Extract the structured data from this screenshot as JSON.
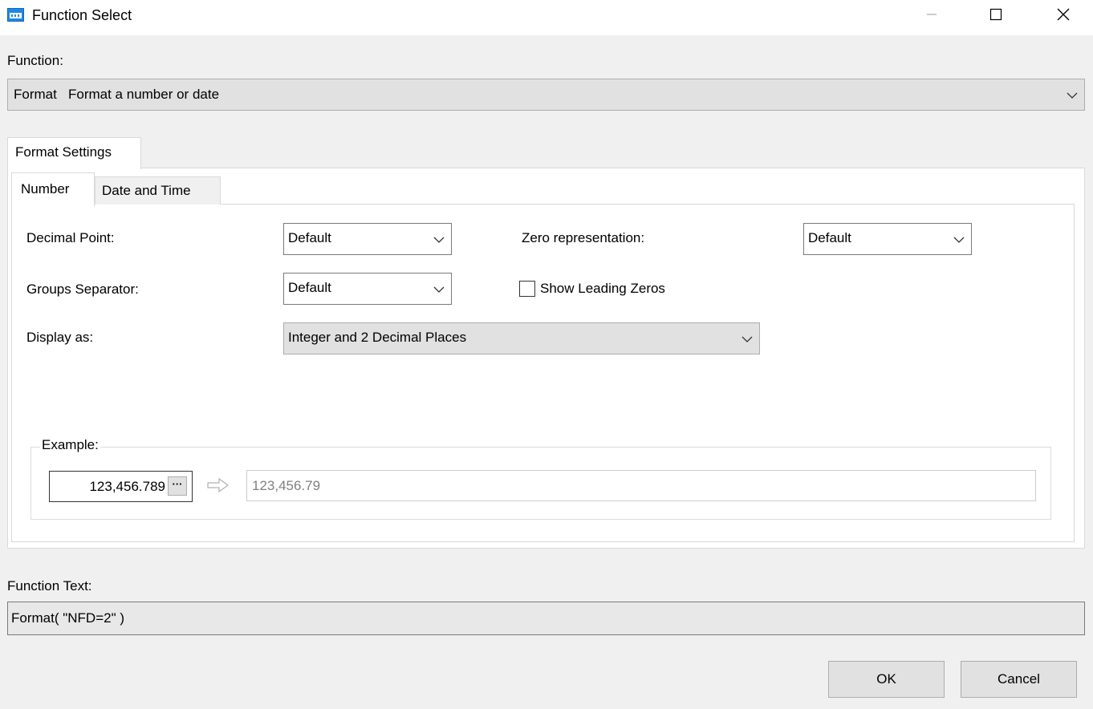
{
  "window": {
    "title": "Function Select",
    "app_icon": "dialog-app-icon",
    "controls": [
      "minimize-icon",
      "maximize-icon",
      "close-icon"
    ]
  },
  "function": {
    "label": "Function:",
    "selected_name": "Format",
    "selected_description": "Format a number or date"
  },
  "tabs": {
    "outer": "Format Settings",
    "inner": [
      "Number",
      "Date and Time"
    ],
    "active_inner": "Number"
  },
  "number": {
    "decimal_point_label": "Decimal Point:",
    "decimal_point_value": "Default",
    "zero_representation_label": "Zero representation:",
    "zero_representation_value": "Default",
    "groups_separator_label": "Groups Separator:",
    "groups_separator_value": "Default",
    "show_leading_zeros_label": "Show Leading Zeros",
    "show_leading_zeros_checked": false,
    "display_as_label": "Display as:",
    "display_as_value": "Integer and 2 Decimal Places"
  },
  "example": {
    "legend": "Example:",
    "input_value": "123,456.789",
    "ellipsis": "···",
    "output_value": "123,456.79"
  },
  "function_text": {
    "label": "Function Text:",
    "value": "Format( \"NFD=2\" )"
  },
  "buttons": {
    "ok": "OK",
    "cancel": "Cancel"
  }
}
